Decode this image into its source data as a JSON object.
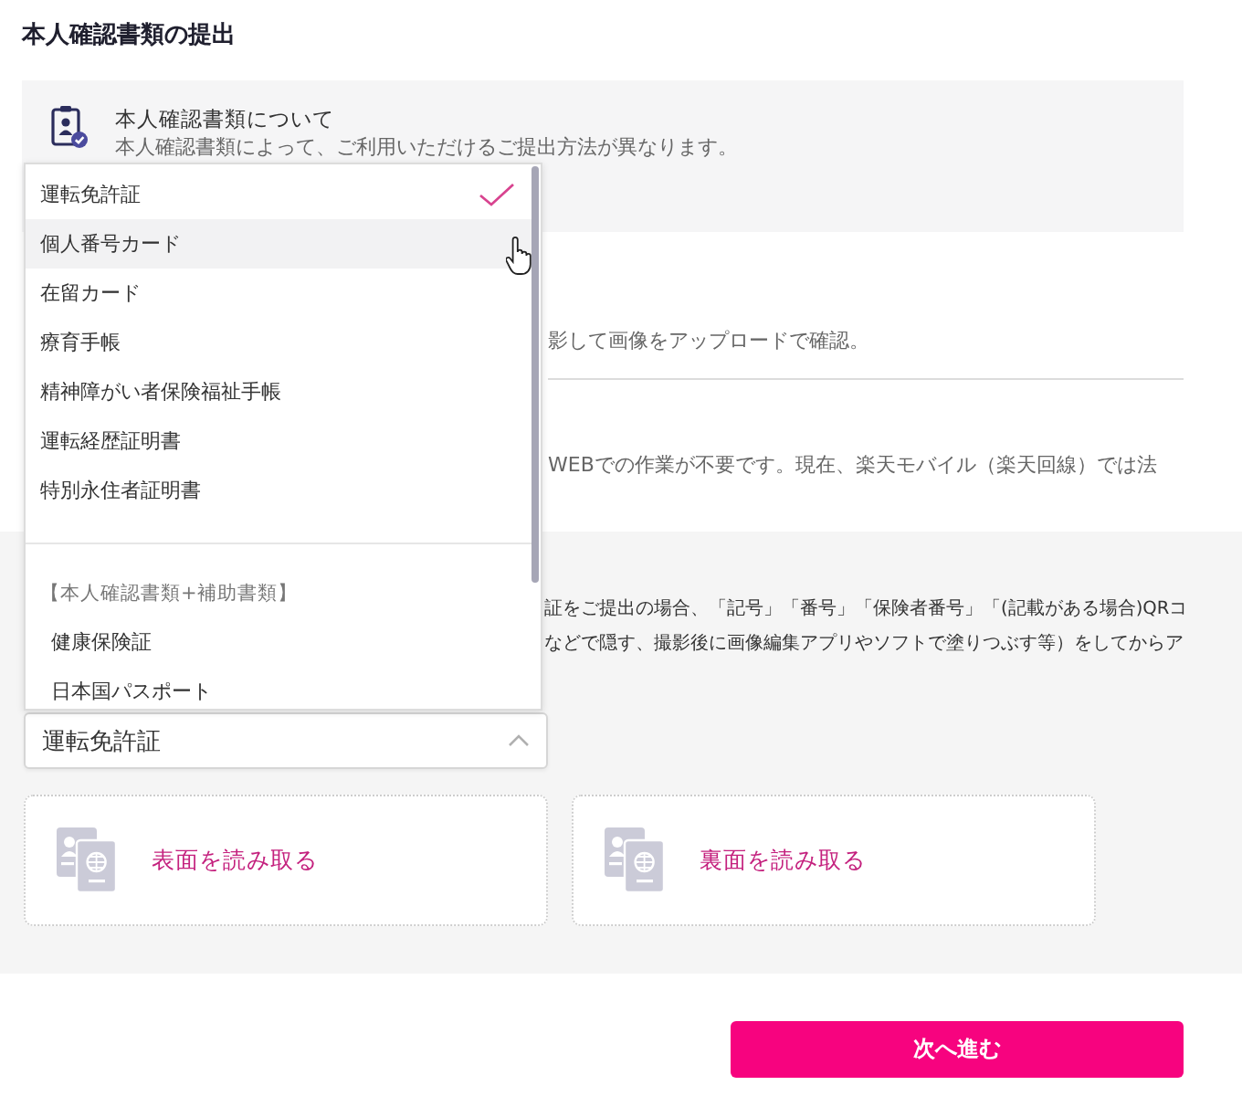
{
  "title": "本人確認書類の提出",
  "info": {
    "heading": "本人確認書類について",
    "text": "本人確認書類によって、ご利用いただけるご提出方法が異なります。"
  },
  "methods": [
    {
      "description": "影して画像をアップロードで確認。"
    },
    {
      "description": "WEBでの作業が不要です。現在、楽天モバイル（楽天回線）では法"
    }
  ],
  "notice": {
    "lines": [
      "証をご提出の場合、「記号」「番号」「保険者番号」「(記載がある場合)QRコ",
      "などで隠す、撮影後に画像編集アプリやソフトで塗りつぶす等）をしてからア"
    ]
  },
  "select": {
    "value": "運転免許証",
    "expanded": true
  },
  "dropdown": {
    "options": [
      {
        "label": "運転免許証",
        "selected": true,
        "hovered": false
      },
      {
        "label": "個人番号カード",
        "selected": false,
        "hovered": true
      },
      {
        "label": "在留カード",
        "selected": false,
        "hovered": false
      },
      {
        "label": "療育手帳",
        "selected": false,
        "hovered": false
      },
      {
        "label": "精神障がい者保険福祉手帳",
        "selected": false,
        "hovered": false
      },
      {
        "label": "運転経歴証明書",
        "selected": false,
        "hovered": false
      },
      {
        "label": "特別永住者証明書",
        "selected": false,
        "hovered": false
      }
    ],
    "groups": [
      {
        "label": "【本人確認書類+補助書類】",
        "options": [
          {
            "label": "健康保険証",
            "selected": false,
            "hovered": false
          },
          {
            "label": "日本国パスポート",
            "selected": false,
            "hovered": false
          }
        ]
      }
    ]
  },
  "uploads": [
    {
      "label": "表面を読み取る"
    },
    {
      "label": "裏面を読み取る"
    }
  ],
  "next_button": "次へ進む"
}
